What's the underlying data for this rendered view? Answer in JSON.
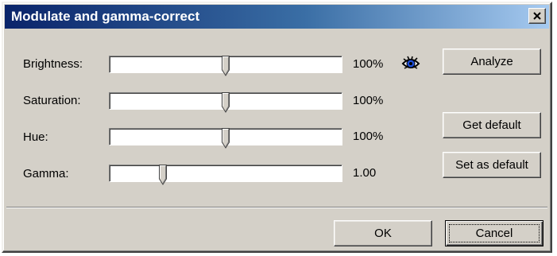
{
  "window": {
    "title": "Modulate and gamma-correct",
    "close_symbol": "×"
  },
  "rows": [
    {
      "label": "Brightness:",
      "value": "100%",
      "slider_fraction": 0.5
    },
    {
      "label": "Saturation:",
      "value": "100%",
      "slider_fraction": 0.5
    },
    {
      "label": "Hue:",
      "value": "100%",
      "slider_fraction": 0.5
    },
    {
      "label": "Gamma:",
      "value": "1.00",
      "slider_fraction": 0.22
    }
  ],
  "buttons": {
    "analyze": "Analyze",
    "get_default": "Get default",
    "set_as_default": "Set as default",
    "ok": "OK",
    "cancel": "Cancel"
  },
  "icons": {
    "preview": "eye-icon",
    "close": "close-icon"
  }
}
